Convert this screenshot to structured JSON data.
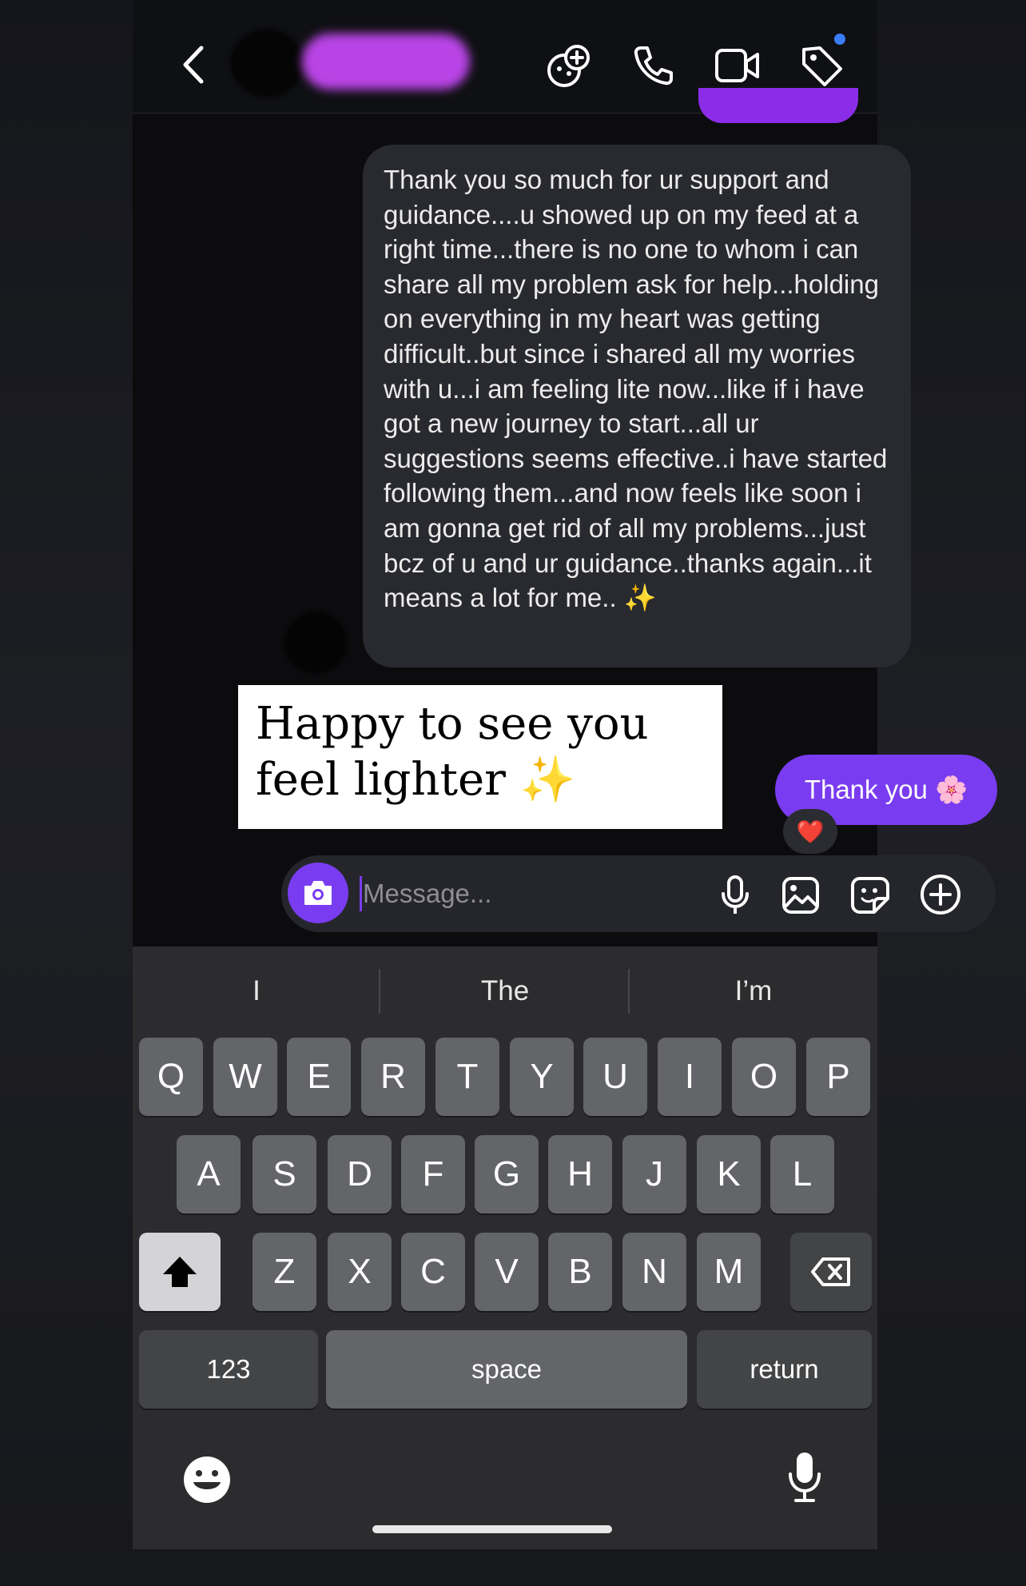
{
  "header": {
    "back_icon": "chevron-left-icon",
    "actions": [
      "add-people-icon",
      "phone-icon",
      "video-icon",
      "tag-icon"
    ],
    "notification_color": "#3a7cf5"
  },
  "messages": {
    "incoming_text": "Thank you so much for ur support and guidance....u showed up on my feed at a right time...there is no one to whom i can share all my problem ask for help...holding on everything in my heart was getting difficult..but since i shared all my worries with u...i am feeling lite now...like if i have got a new journey to start...all ur suggestions seems effective..i have started following them...and now feels like soon i am gonna get rid of all my problems...just bcz of u and ur guidance..thanks again...it means a lot for me.. ✨",
    "outgoing_text": "Thank you 🌸",
    "reaction": "❤️",
    "outgoing_color": "#7a3cf0"
  },
  "overlay": {
    "text": "Happy to see you feel lighter ✨"
  },
  "composer": {
    "placeholder": "Message...",
    "value": "",
    "icons": [
      "camera-icon",
      "microphone-icon",
      "gallery-icon",
      "sticker-icon",
      "plus-circle-icon"
    ]
  },
  "keyboard": {
    "suggestions": [
      "I",
      "The",
      "I’m"
    ],
    "row1": [
      "Q",
      "W",
      "E",
      "R",
      "T",
      "Y",
      "U",
      "I",
      "O",
      "P"
    ],
    "row2": [
      "A",
      "S",
      "D",
      "F",
      "G",
      "H",
      "J",
      "K",
      "L"
    ],
    "row3": [
      "Z",
      "X",
      "C",
      "V",
      "B",
      "N",
      "M"
    ],
    "numbers_label": "123",
    "space_label": "space",
    "return_label": "return"
  }
}
